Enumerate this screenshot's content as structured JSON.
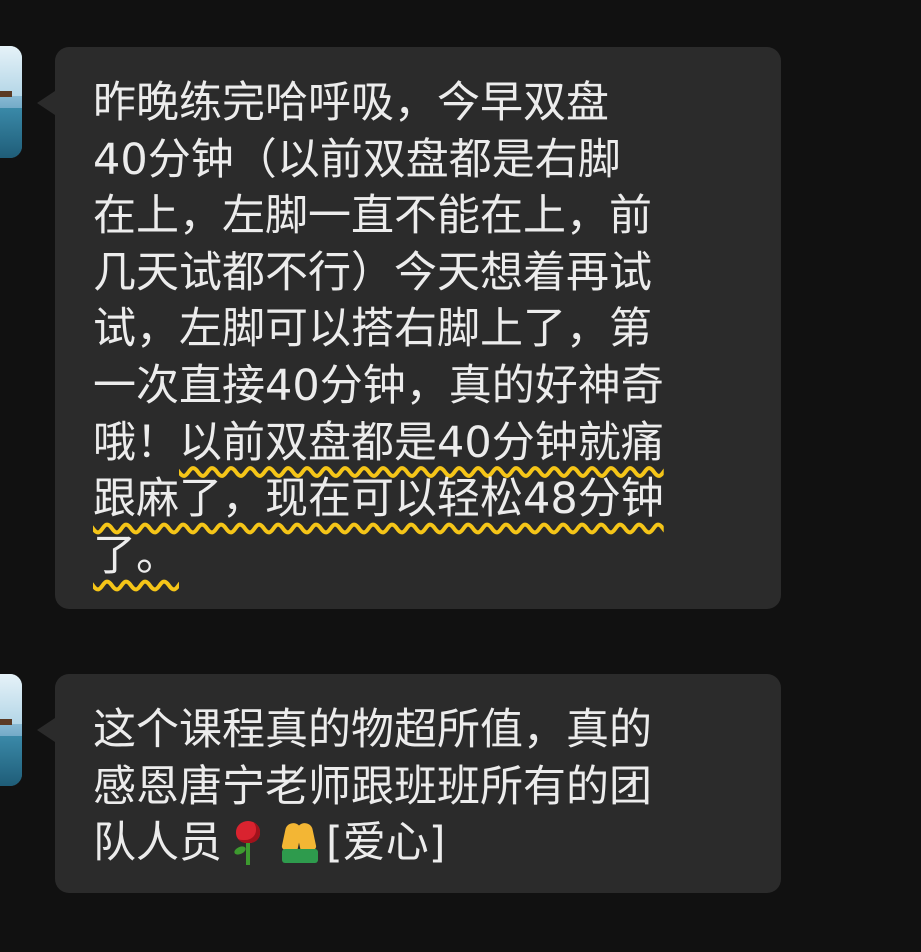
{
  "messages": [
    {
      "lines": [
        "昨晚练完哈呼吸，今早双盘",
        "40分钟（以前双盘都是右脚",
        "在上，左脚一直不能在上，前",
        "几天试都不行）今天想着再试",
        "试，左脚可以搭右脚上了，第",
        "一次直接40分钟，真的好神奇",
        "哦！",
        "以前双盘都是40分钟就痛",
        "跟麻了，现在可以轻松48分钟",
        "了。"
      ],
      "highlight_color": "#f5c518"
    },
    {
      "lines": [
        "这个课程真的物超所值，真的",
        "感恩唐宁老师跟班班所有的团",
        "队人员"
      ],
      "emojis": [
        "rose-icon",
        "pray-icon"
      ],
      "tail_text": "[爱心]"
    }
  ]
}
